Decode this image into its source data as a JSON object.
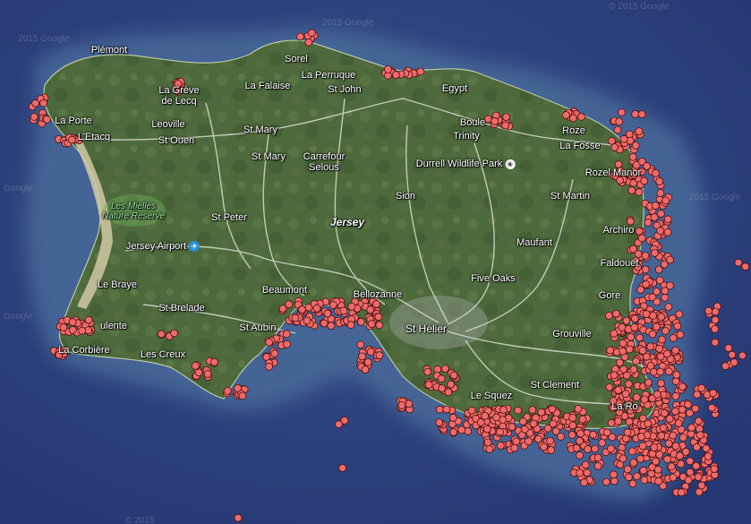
{
  "map": {
    "island_name": "Jersey",
    "colors": {
      "sea": "#2b3f7a",
      "shallow": "#3f5c8f",
      "land": "#4f6b3e",
      "road": "#dfe3d6",
      "marker_fill": "#ef6a68",
      "marker_stroke": "#4a0f0f"
    },
    "places": [
      {
        "id": "plemont",
        "label": "Plémont"
      },
      {
        "id": "sorel",
        "label": "Sorel"
      },
      {
        "id": "la-perruque",
        "label": "La Perruque"
      },
      {
        "id": "la-greve-de-lecq",
        "label": "La Grève de Lecq"
      },
      {
        "id": "la-falaise",
        "label": "La Falaise"
      },
      {
        "id": "st-john",
        "label": "St John"
      },
      {
        "id": "egypt",
        "label": "Egypt"
      },
      {
        "id": "la-porte",
        "label": "La Porte"
      },
      {
        "id": "leoville",
        "label": "Leoville"
      },
      {
        "id": "l-etacq",
        "label": "L'Etacq"
      },
      {
        "id": "st-ouen",
        "label": "St Ouen"
      },
      {
        "id": "st-mary-1",
        "label": "St Mary"
      },
      {
        "id": "st-mary-2",
        "label": "St Mary"
      },
      {
        "id": "carrefour-selous",
        "label": "Carrefour Selous"
      },
      {
        "id": "boulay",
        "label": "Boule"
      },
      {
        "id": "trinity",
        "label": "Trinity"
      },
      {
        "id": "durrell",
        "label": "Durrell Wildlife Park"
      },
      {
        "id": "rozel",
        "label": "Roze"
      },
      {
        "id": "la-fosse",
        "label": "La Fosse"
      },
      {
        "id": "rozel-manor",
        "label": "Rozel Manor"
      },
      {
        "id": "les-mielles",
        "label": "Les Mielles Nature Reserve"
      },
      {
        "id": "sion",
        "label": "Sion"
      },
      {
        "id": "st-martin",
        "label": "St Martin"
      },
      {
        "id": "st-peter",
        "label": "St Peter"
      },
      {
        "id": "jersey",
        "label": "Jersey"
      },
      {
        "id": "archirondel",
        "label": "Archiro"
      },
      {
        "id": "jersey-airport",
        "label": "Jersey Airport"
      },
      {
        "id": "maufant",
        "label": "Maufant"
      },
      {
        "id": "faldouet",
        "label": "Faldouët"
      },
      {
        "id": "five-oaks",
        "label": "Five Oaks"
      },
      {
        "id": "le-braye",
        "label": "Le Braye"
      },
      {
        "id": "beaumont",
        "label": "Beaumont"
      },
      {
        "id": "bellozanne",
        "label": "Bellozanne"
      },
      {
        "id": "gorey",
        "label": "Gore"
      },
      {
        "id": "st-brelade",
        "label": "St Brelade"
      },
      {
        "id": "st-helier",
        "label": "St Helier"
      },
      {
        "id": "la-moye",
        "label": "ulente"
      },
      {
        "id": "st-aubin",
        "label": "St Aubin"
      },
      {
        "id": "grouville",
        "label": "Grouville"
      },
      {
        "id": "la-corbiere",
        "label": "La Corbière"
      },
      {
        "id": "les-creux",
        "label": "Les Creux"
      },
      {
        "id": "le-squez",
        "label": "Le Squez"
      },
      {
        "id": "st-clement",
        "label": "St Clement"
      },
      {
        "id": "la-rocque",
        "label": "La Ro"
      }
    ],
    "watermarks": [
      "2015 Google",
      "2015 Google",
      "Google",
      "Google",
      "2015 Google",
      "© 2015 Google",
      "© 2015"
    ]
  }
}
